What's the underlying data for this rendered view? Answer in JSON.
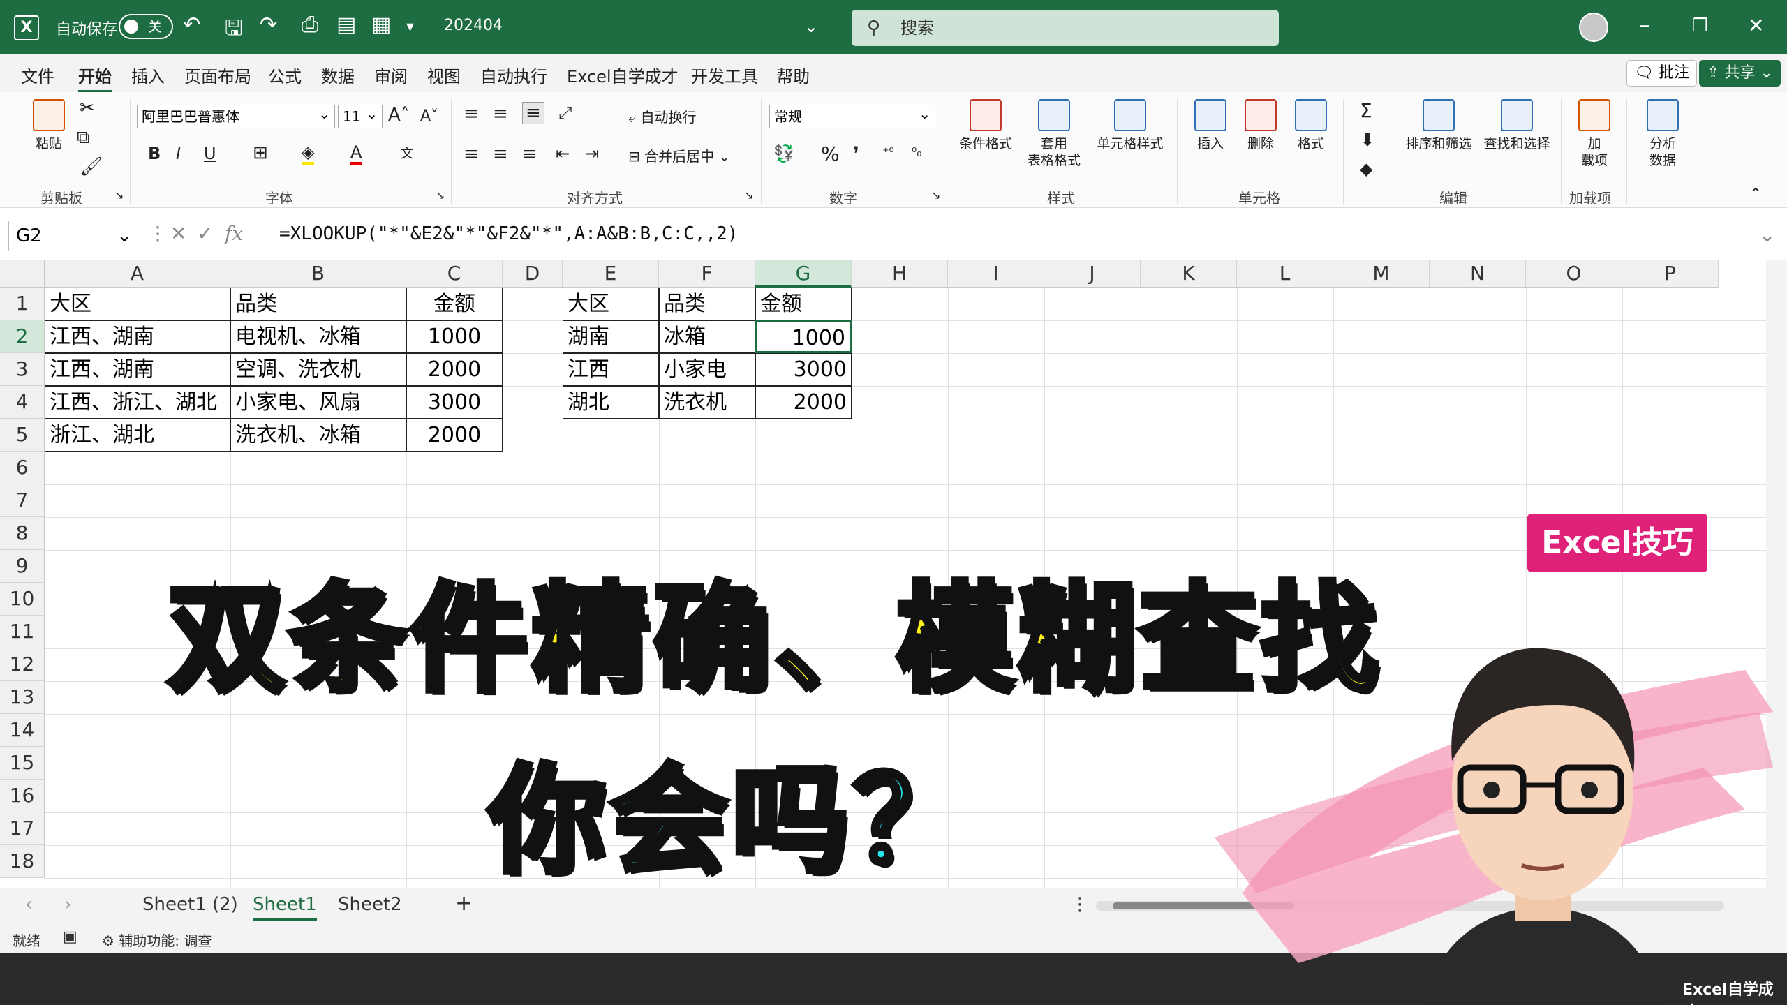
{
  "titlebar": {
    "autosave_label": "自动保存",
    "toggle_state": "关",
    "filename": "202404",
    "search_placeholder": "搜索"
  },
  "menu": {
    "items": [
      "文件",
      "开始",
      "插入",
      "页面布局",
      "公式",
      "数据",
      "审阅",
      "视图",
      "自动执行",
      "Excel自学成才",
      "开发工具",
      "帮助"
    ],
    "active": "开始",
    "comment_btn": "批注",
    "share_btn": "共享"
  },
  "ribbon": {
    "clipboard": {
      "paste": "粘贴",
      "label": "剪贴板"
    },
    "font": {
      "name": "阿里巴巴普惠体",
      "size": "11",
      "label": "字体"
    },
    "align": {
      "wrap": "自动换行",
      "merge": "合并后居中",
      "label": "对齐方式"
    },
    "number": {
      "format": "常规",
      "label": "数字"
    },
    "styles": {
      "cond": "条件格式",
      "table1": "套用",
      "table2": "表格格式",
      "cell": "单元格样式",
      "label": "样式"
    },
    "cells": {
      "insert": "插入",
      "delete": "删除",
      "format": "格式",
      "label": "单元格"
    },
    "edit": {
      "sort": "排序和筛选",
      "find": "查找和选择",
      "label": "编辑"
    },
    "addins": {
      "a1": "加",
      "a2": "载项",
      "label": "加载项"
    },
    "analysis": {
      "a1": "分析",
      "a2": "数据"
    }
  },
  "formula": {
    "namebox": "G2",
    "formula": "=XLOOKUP(\"*\"&E2&\"*\"&F2&\"*\",A:A&B:B,C:C,,2)"
  },
  "columns": [
    "A",
    "B",
    "C",
    "D",
    "E",
    "F",
    "G",
    "H",
    "I",
    "J",
    "K",
    "L",
    "M",
    "N",
    "O",
    "P"
  ],
  "rows": [
    "1",
    "2",
    "3",
    "4",
    "5",
    "6",
    "7",
    "8",
    "9",
    "10",
    "11",
    "12",
    "13",
    "14",
    "15",
    "16",
    "17",
    "18"
  ],
  "table1": {
    "headers": [
      "大区",
      "品类",
      "金额"
    ],
    "rows": [
      [
        "江西、湖南",
        "电视机、冰箱",
        "1000"
      ],
      [
        "江西、湖南",
        "空调、洗衣机",
        "2000"
      ],
      [
        "江西、浙江、湖北",
        "小家电、风扇",
        "3000"
      ],
      [
        "浙江、湖北",
        "洗衣机、冰箱",
        "2000"
      ]
    ]
  },
  "table2": {
    "headers": [
      "大区",
      "品类",
      "金额"
    ],
    "rows": [
      [
        "湖南",
        "冰箱",
        "1000"
      ],
      [
        "江西",
        "小家电",
        "3000"
      ],
      [
        "湖北",
        "洗衣机",
        "2000"
      ]
    ]
  },
  "sheets": {
    "tabs": [
      "Sheet1 (2)",
      "Sheet1",
      "Sheet2"
    ],
    "active": "Sheet1"
  },
  "status": {
    "ready": "就绪",
    "accessibility": "辅助功能: 调查"
  },
  "overlay": {
    "title": "双条件精确、模糊查找",
    "subtitle": "你会吗？",
    "badge": "Excel技巧",
    "brand": "Excel自学成才"
  }
}
